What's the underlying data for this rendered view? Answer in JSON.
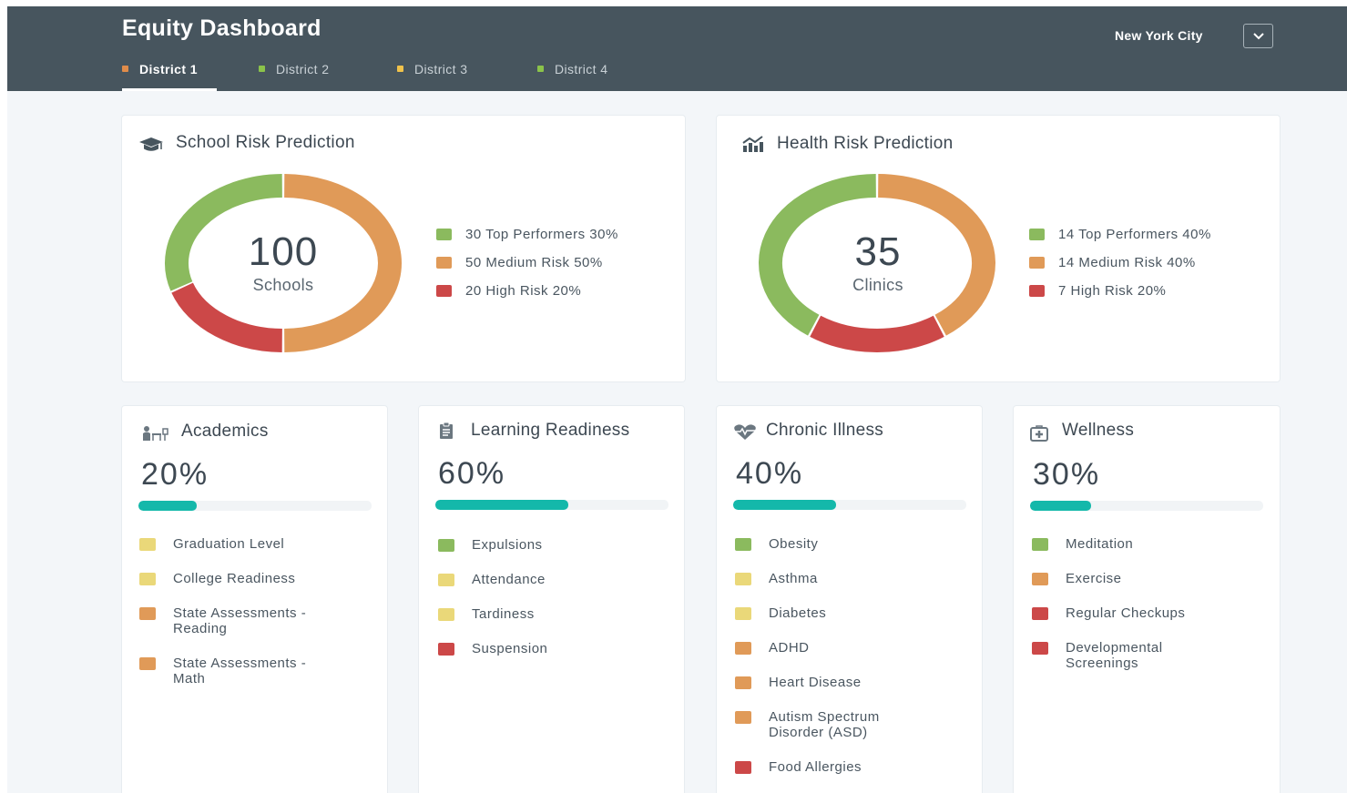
{
  "colors": {
    "header_bg": "#47555e",
    "green": "#8bba5e",
    "orange": "#e09a58",
    "red": "#cc4848",
    "yellow": "#ead879",
    "teal": "#14b8aa"
  },
  "header": {
    "title": "Equity Dashboard",
    "tabs": [
      {
        "label": "District 1",
        "color": "#e08c4a",
        "active": true
      },
      {
        "label": "District 2",
        "color": "#8bc34a",
        "active": false
      },
      {
        "label": "District 3",
        "color": "#f0c24b",
        "active": false
      },
      {
        "label": "District 4",
        "color": "#8bc34a",
        "active": false
      }
    ],
    "city": "New York City",
    "city_toggle_icon": "chevron-down-icon"
  },
  "school_risk": {
    "title": "School Risk Prediction",
    "icon": "graduation-cap-icon",
    "total": "100",
    "unit": "Schools",
    "segments": [
      {
        "label": "30 Top Performers 30%",
        "value": 30,
        "color": "#8bba5e"
      },
      {
        "label": "50 Medium Risk 50%",
        "value": 50,
        "color": "#e09a58"
      },
      {
        "label": "20 High Risk 20%",
        "value": 20,
        "color": "#cc4848"
      }
    ]
  },
  "health_risk": {
    "title": "Health Risk Prediction",
    "icon": "chart-trend-icon",
    "total": "35",
    "unit": "Clinics",
    "segments": [
      {
        "label": "14 Top Performers 40%",
        "value": 40,
        "color": "#8bba5e"
      },
      {
        "label": "14 Medium Risk 40%",
        "value": 40,
        "color": "#e09a58"
      },
      {
        "label": "7 High Risk 20%",
        "value": 20,
        "color": "#cc4848"
      }
    ]
  },
  "metrics": [
    {
      "title": "Academics",
      "icon": "classroom-icon",
      "percent": "20%",
      "progress": 0.25,
      "items": [
        {
          "label": "Graduation Level",
          "color": "#ead879"
        },
        {
          "label": "College Readiness",
          "color": "#ead879"
        },
        {
          "label": "State Assessments - Reading",
          "color": "#e09a58"
        },
        {
          "label": "State Assessments - Math",
          "color": "#e09a58"
        }
      ]
    },
    {
      "title": "Learning Readiness",
      "icon": "clipboard-icon",
      "percent": "60%",
      "progress": 0.57,
      "items": [
        {
          "label": "Expulsions",
          "color": "#8bba5e"
        },
        {
          "label": "Attendance",
          "color": "#ead879"
        },
        {
          "label": "Tardiness",
          "color": "#ead879"
        },
        {
          "label": "Suspension",
          "color": "#cc4848"
        }
      ]
    },
    {
      "title": "Chronic Illness",
      "icon": "heartbeat-icon",
      "percent": "40%",
      "progress": 0.44,
      "items": [
        {
          "label": "Obesity",
          "color": "#8bba5e"
        },
        {
          "label": "Asthma",
          "color": "#ead879"
        },
        {
          "label": "Diabetes",
          "color": "#ead879"
        },
        {
          "label": "ADHD",
          "color": "#e09a58"
        },
        {
          "label": "Heart Disease",
          "color": "#e09a58"
        },
        {
          "label": "Autism Spectrum Disorder (ASD)",
          "color": "#e09a58"
        },
        {
          "label": "Food Allergies",
          "color": "#cc4848"
        }
      ]
    },
    {
      "title": "Wellness",
      "icon": "medical-kit-icon",
      "percent": "30%",
      "progress": 0.26,
      "items": [
        {
          "label": "Meditation",
          "color": "#8bba5e"
        },
        {
          "label": "Exercise",
          "color": "#e09a58"
        },
        {
          "label": "Regular Checkups",
          "color": "#cc4848"
        },
        {
          "label": "Developmental Screenings",
          "color": "#cc4848"
        }
      ]
    }
  ]
}
